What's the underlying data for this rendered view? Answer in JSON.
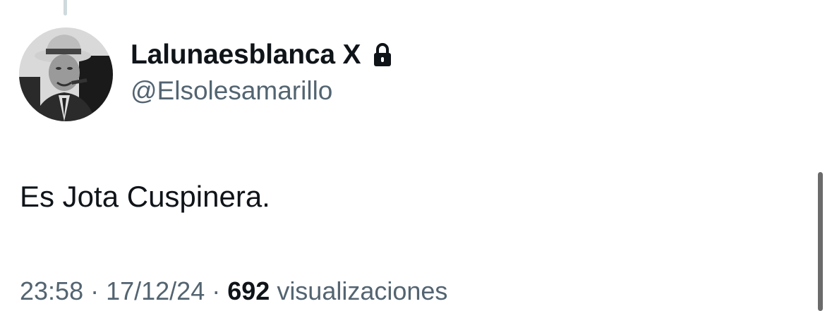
{
  "author": {
    "display_name": "Lalunaesblanca X",
    "handle": "@Elsolesamarillo",
    "protected": true,
    "avatar_icon": "vintage-portrait-man-with-hat-and-cigar",
    "lock_icon": "lock-icon"
  },
  "tweet": {
    "text": "Es Jota Cuspinera."
  },
  "meta": {
    "time": "23:58",
    "separator": "·",
    "date": "17/12/24",
    "views_count": "692",
    "views_label": "visualizaciones"
  },
  "colors": {
    "primary_text": "#0f1419",
    "secondary_text": "#536471",
    "thread_line": "#cfd9de",
    "background": "#ffffff"
  }
}
